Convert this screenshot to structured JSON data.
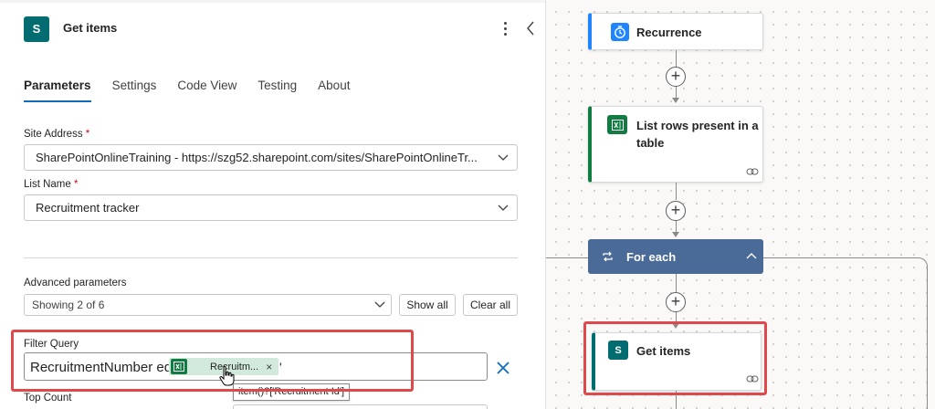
{
  "panel": {
    "title": "Get items",
    "icon": "sharepoint-icon",
    "tabs": [
      {
        "label": "Parameters",
        "active": true
      },
      {
        "label": "Settings",
        "active": false
      },
      {
        "label": "Code View",
        "active": false
      },
      {
        "label": "Testing",
        "active": false
      },
      {
        "label": "About",
        "active": false
      }
    ],
    "site_address": {
      "label": "Site Address",
      "required_mark": "*",
      "value": "SharePointOnlineTraining - https://szg52.sharepoint.com/sites/SharePointOnlineTr..."
    },
    "list_name": {
      "label": "List Name",
      "required_mark": "*",
      "value": "Recruitment tracker"
    },
    "advanced": {
      "label": "Advanced parameters",
      "value": "Showing 2 of 6",
      "show_all": "Show all",
      "clear_all": "Clear all"
    },
    "filter_query": {
      "label": "Filter Query",
      "prefix_text": "RecruitmentNumber eq '",
      "token_label": "Recruitm...",
      "token_close": "×",
      "suffix_text": "'",
      "token_tooltip": "item()?['Recruitment Id']"
    },
    "top_count": {
      "label": "Top Count"
    }
  },
  "canvas": {
    "recurrence": {
      "title": "Recurrence",
      "icon": "clock-icon",
      "accent": "#1f85ff"
    },
    "list_rows": {
      "title_line1": "List rows present in a",
      "title_line2": "table",
      "icon": "excel-icon",
      "accent": "#107c41"
    },
    "for_each": {
      "title": "For each",
      "icon": "loop-icon",
      "color": "#4a6b98"
    },
    "get_items": {
      "title": "Get items",
      "icon": "sharepoint-icon",
      "accent": "#036c70"
    }
  },
  "colors": {
    "highlight": "#e0494c",
    "active_tab": "#0f6cbd",
    "token_bg": "#d2eadc"
  }
}
